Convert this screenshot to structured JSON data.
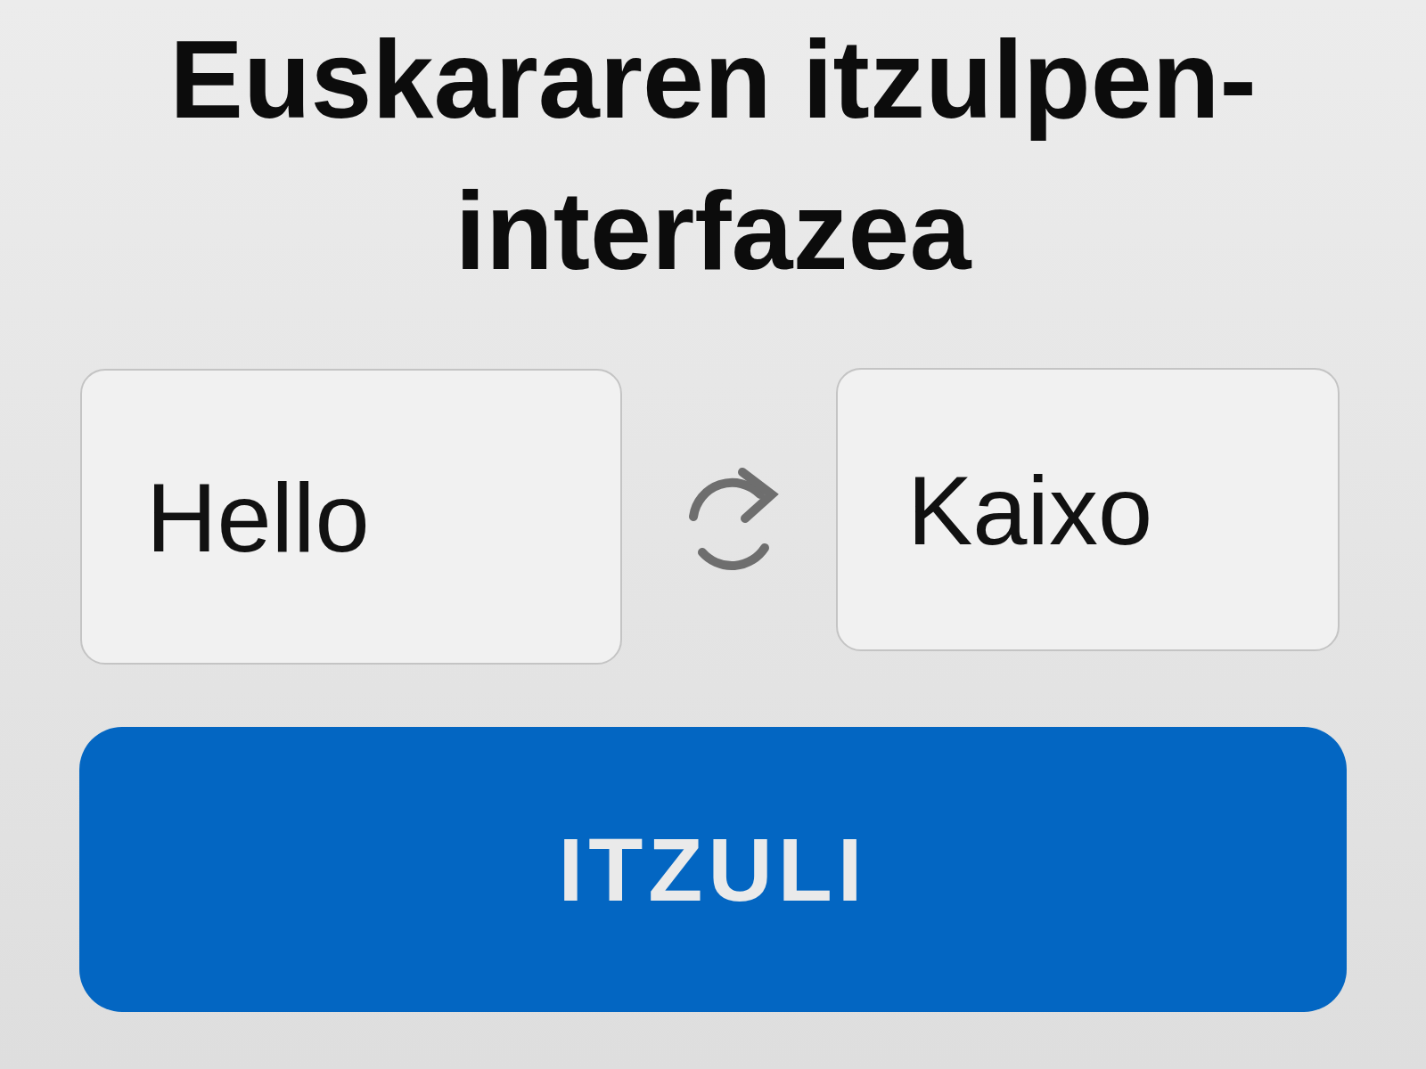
{
  "title": "Euskararen itzulpen-interfazea",
  "source": {
    "value": "Hello"
  },
  "target": {
    "value": "Kaixo"
  },
  "button": {
    "label": "ITZULI"
  }
}
